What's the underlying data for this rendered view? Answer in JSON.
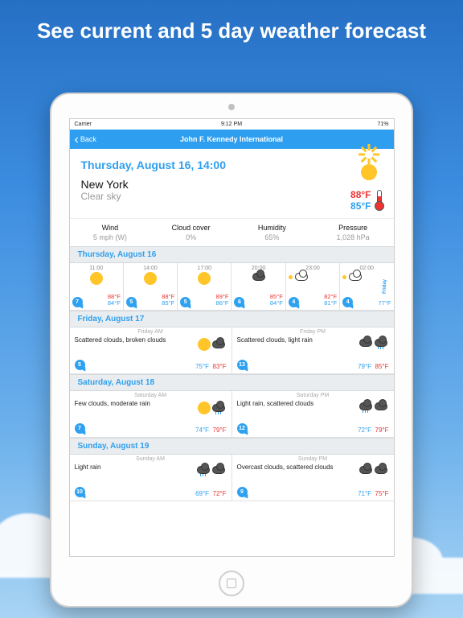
{
  "promo": {
    "headline": "See current and 5 day weather forecast"
  },
  "statusbar": {
    "carrier": "Carrier",
    "time": "9:12 PM",
    "battery": "71%",
    "wifi": "◉"
  },
  "navbar": {
    "back": "Back",
    "title": "John F. Kennedy International"
  },
  "current": {
    "date": "Thursday, August 16, 14:00",
    "city": "New York",
    "condition": "Clear sky",
    "hi": "88°F",
    "lo": "85°F"
  },
  "metrics": {
    "wind": {
      "label": "Wind",
      "value": "5 mph (W)"
    },
    "cloud": {
      "label": "Cloud cover",
      "value": "0%"
    },
    "humidity": {
      "label": "Humidity",
      "value": "65%"
    },
    "pressure": {
      "label": "Pressure",
      "value": "1,028 hPa"
    }
  },
  "hourly": {
    "header": "Thursday, August 16",
    "slots": [
      {
        "time": "11:00",
        "icon": "sun",
        "b": "7",
        "hi": "88°F",
        "lo": "84°F"
      },
      {
        "time": "14:00",
        "icon": "sun",
        "b": "5",
        "hi": "88°F",
        "lo": "85°F"
      },
      {
        "time": "17:00",
        "icon": "sun",
        "b": "5",
        "hi": "89°F",
        "lo": "86°F"
      },
      {
        "time": "20:00",
        "icon": "cloud",
        "b": "6",
        "hi": "85°F",
        "lo": "84°F"
      },
      {
        "time": "23:00",
        "icon": "cloudsun",
        "b": "4",
        "hi": "82°F",
        "lo": "81°F"
      },
      {
        "time": "02:00",
        "icon": "cloudsun",
        "b": "4",
        "hi": "",
        "lo": "77°F",
        "vlabel": "Friday"
      }
    ]
  },
  "days": [
    {
      "header": "Friday, August 17",
      "am": {
        "label": "Friday AM",
        "desc": "Scattered clouds, broken clouds",
        "b": "5",
        "lo": "75°F",
        "hi": "83°F",
        "ic": [
          "sun",
          "cloud"
        ]
      },
      "pm": {
        "label": "Friday PM",
        "desc": "Scattered clouds, light rain",
        "b": "13",
        "lo": "79°F",
        "hi": "85°F",
        "ic": [
          "cloud",
          "rain"
        ]
      }
    },
    {
      "header": "Saturday, August 18",
      "am": {
        "label": "Saturday AM",
        "desc": "Few clouds, moderate rain",
        "b": "7",
        "lo": "74°F",
        "hi": "79°F",
        "ic": [
          "sun",
          "rain"
        ]
      },
      "pm": {
        "label": "Saturday PM",
        "desc": "Light rain, scattered clouds",
        "b": "12",
        "lo": "72°F",
        "hi": "79°F",
        "ic": [
          "rain",
          "cloud"
        ]
      }
    },
    {
      "header": "Sunday, August 19",
      "am": {
        "label": "Sunday AM",
        "desc": "Light rain",
        "b": "10",
        "lo": "69°F",
        "hi": "72°F",
        "ic": [
          "rain",
          "cloud"
        ]
      },
      "pm": {
        "label": "Sunday PM",
        "desc": "Overcast clouds, scattered clouds",
        "b": "9",
        "lo": "71°F",
        "hi": "75°F",
        "ic": [
          "cloud",
          "cloud"
        ]
      }
    }
  ]
}
